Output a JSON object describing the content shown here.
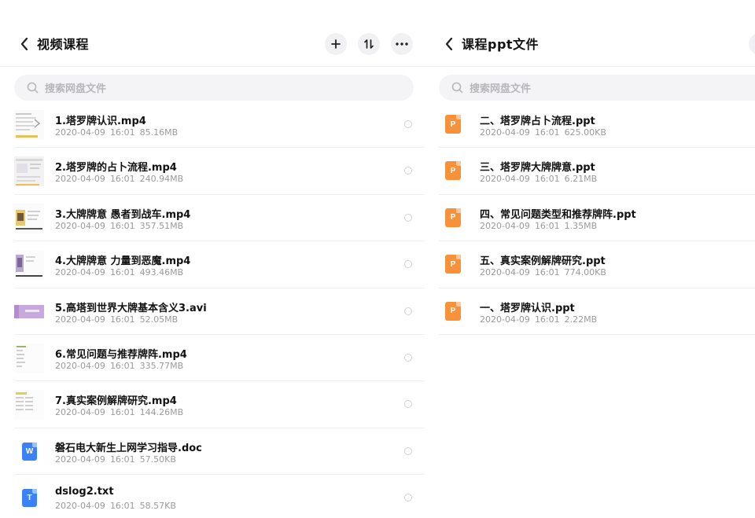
{
  "left_panel": {
    "title": "视频课程",
    "search_placeholder": "搜索网盘文件",
    "files": [
      {
        "name": "1.塔罗牌认识.mp4",
        "date": "2020-04-09",
        "time": "16:01",
        "size": "85.16MB",
        "kind": "video-thumbnail"
      },
      {
        "name": "2.塔罗牌的占卜流程.mp4",
        "date": "2020-04-09",
        "time": "16:01",
        "size": "240.94MB",
        "kind": "video-thumbnail"
      },
      {
        "name": "3.大牌牌意 愚者到战车.mp4",
        "date": "2020-04-09",
        "time": "16:01",
        "size": "357.51MB",
        "kind": "video-thumbnail"
      },
      {
        "name": "4.大牌牌意 力量到恶魔.mp4",
        "date": "2020-04-09",
        "time": "16:01",
        "size": "493.46MB",
        "kind": "video-thumbnail"
      },
      {
        "name": "5.高塔到世界大牌基本含义3.avi",
        "date": "2020-04-09",
        "time": "16:01",
        "size": "52.05MB",
        "kind": "video-thumbnail"
      },
      {
        "name": "6.常见问题与推荐牌阵.mp4",
        "date": "2020-04-09",
        "time": "16:01",
        "size": "335.77MB",
        "kind": "video-thumbnail"
      },
      {
        "name": "7.真实案例解牌研究.mp4",
        "date": "2020-04-09",
        "time": "16:01",
        "size": "144.26MB",
        "kind": "video-thumbnail"
      },
      {
        "name": "磐石电大新生上网学习指导.doc",
        "date": "2020-04-09",
        "time": "16:01",
        "size": "57.50KB",
        "kind": "word-icon",
        "icon_letter": "W"
      },
      {
        "name": "dslog2.txt",
        "date": "2020-04-09",
        "time": "16:01",
        "size": "58.57KB",
        "kind": "text-icon",
        "icon_letter": "T"
      }
    ]
  },
  "right_panel": {
    "title": "课程ppt文件",
    "search_placeholder": "搜索网盘文件",
    "files": [
      {
        "name": "二、塔罗牌占卜流程.ppt",
        "date": "2020-04-09",
        "time": "16:01",
        "size": "625.00KB",
        "kind": "ppt-icon",
        "icon_letter": "P"
      },
      {
        "name": "三、塔罗牌大牌牌意.ppt",
        "date": "2020-04-09",
        "time": "16:01",
        "size": "6.21MB",
        "kind": "ppt-icon",
        "icon_letter": "P"
      },
      {
        "name": "四、常见问题类型和推荐牌阵.ppt",
        "date": "2020-04-09",
        "time": "16:01",
        "size": "1.35MB",
        "kind": "ppt-icon",
        "icon_letter": "P"
      },
      {
        "name": "五、真实案例解牌研究.ppt",
        "date": "2020-04-09",
        "time": "16:01",
        "size": "774.00KB",
        "kind": "ppt-icon",
        "icon_letter": "P"
      },
      {
        "name": "一、塔罗牌认识.ppt",
        "date": "2020-04-09",
        "time": "16:01",
        "size": "2.22MB",
        "kind": "ppt-icon",
        "icon_letter": "P"
      }
    ]
  },
  "colors": {
    "ppt_orange": "#f7923a",
    "word_blue": "#3b82f6",
    "text_blue": "#3b82f6",
    "meta_gray": "#9a9a9e"
  },
  "icons": {
    "back": "chevron-left-icon",
    "add": "plus-icon",
    "sort": "sort-icon",
    "more": "more-horizontal-icon",
    "search": "search-icon"
  }
}
